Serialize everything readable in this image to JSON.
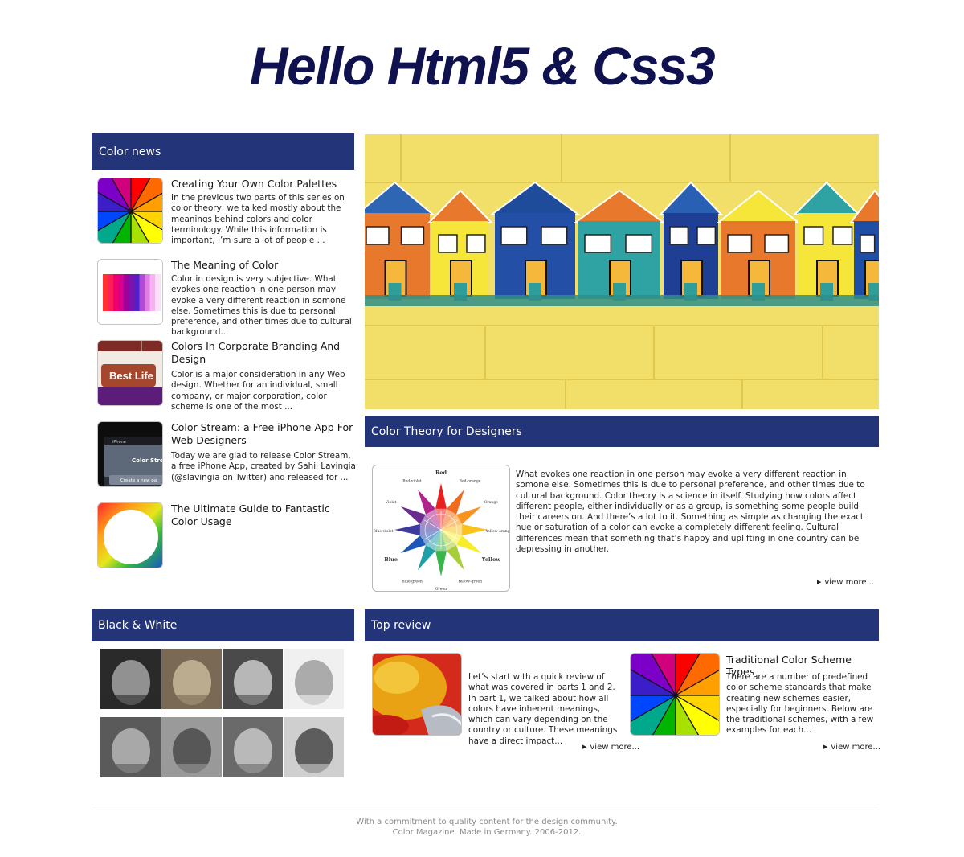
{
  "site": {
    "title": "Hello Html5 & Css3"
  },
  "color_news": {
    "heading": "Color news",
    "items": [
      {
        "title": "Creating Your Own Color Palettes",
        "excerpt": "In the previous two parts of this series on color theory, we talked mostly about the meanings behind colors and color terminology. While this information is important, I’m sure a lot of people ...",
        "icon": "color-wheel-thumb"
      },
      {
        "title": "The Meaning of Color",
        "excerpt": "Color in design is very subjective. What evokes one reaction in one person may evoke a very different reaction in somone else. Sometimes this is due to personal preference, and other times due to cultural background...",
        "icon": "color-stripes-thumb"
      },
      {
        "title": "Colors In Corporate Branding And Design",
        "excerpt": "Color is a major consideration in any Web design. Whether for an individual, small company, or major corporation, color scheme is one of the most ...",
        "icon": "brand-thumb",
        "thumb_label": "Best Life"
      },
      {
        "title": "Color Stream: a Free iPhone App For Web Designers",
        "excerpt": "Today we are glad to release Color Stream, a free iPhone App, created by Sahil Lavingia (@slavingia on Twitter) and released for ...",
        "icon": "iphone-thumb",
        "thumb_labels": [
          "iPhone",
          "Color Strea",
          "Create a new pa"
        ]
      },
      {
        "title": "The Ultimate Guide to Fantastic Color Usage",
        "excerpt": "",
        "icon": "color-ring-thumb"
      }
    ]
  },
  "feature": {
    "heading": "Color Theory for Designers",
    "text": "What evokes one reaction in one person may evoke a very different reaction in somone else. Sometimes this is due to personal preference, and other times due to cultural background. Color theory is a science in itself. Studying how colors affect different people, either individually or as a group, is something some people build their careers on. And there’s a lot to it. Something as simple as changing the exact hue or saturation of a color can evoke a completely different feeling. Cultural differences mean that something that’s happy and uplifting in one country can be depressing in another.",
    "more": "view more...",
    "wheel_labels": [
      "Red",
      "Red-orange",
      "Orange",
      "Yellow-orange",
      "Yellow",
      "Yellow-green",
      "Green",
      "Blue-green",
      "Blue",
      "Blue-violet",
      "Violet",
      "Red-violet"
    ],
    "wheel_colors": [
      "#e8211f",
      "#f26b1d",
      "#f7931e",
      "#fbc21b",
      "#f5ee28",
      "#a6ce39",
      "#39b54a",
      "#1f9fa8",
      "#1c57b8",
      "#3d3b9e",
      "#6a2c91",
      "#b0228c"
    ]
  },
  "bw": {
    "heading": "Black & White",
    "photos": 8
  },
  "top_review": {
    "heading": "Top review",
    "items": [
      {
        "title": "",
        "excerpt": "Let’s start with a quick review of what was covered in parts 1 and 2. In part 1, we talked about how all colors have inherent meanings, which can vary depending on the country or culture. These meanings have a direct impact...",
        "more": "view more..."
      },
      {
        "title": "Traditional Color Scheme Types",
        "excerpt": "There are a number of predefined color scheme standards that make creating new schemes easier, especially for beginners. Below are the traditional schemes, with a few examples for each...",
        "more": "view more..."
      }
    ]
  },
  "footer": {
    "line1": "With a commitment to quality content for the design community.",
    "line2": "Color Magazine. Made in Germany. 2006-2012."
  }
}
